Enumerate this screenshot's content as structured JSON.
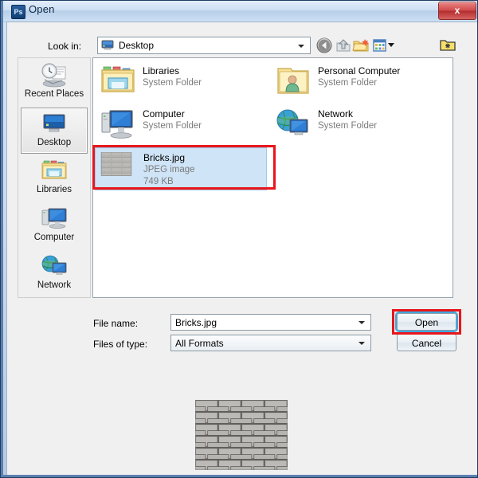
{
  "window": {
    "title": "Open",
    "app_icon": "photoshop-ps-icon",
    "close_label": "x"
  },
  "toolbar": {
    "lookin_label": "Look in:",
    "lookin_value": "Desktop",
    "lookin_icon": "desktop-monitor-icon",
    "buttons": [
      {
        "name": "back-icon",
        "tooltip": "Back"
      },
      {
        "name": "up-folder-icon",
        "tooltip": "Up one level"
      },
      {
        "name": "new-folder-icon",
        "tooltip": "Create new folder"
      },
      {
        "name": "views-icon",
        "tooltip": "Views"
      },
      {
        "name": "special-folder-icon",
        "tooltip": "Special folder"
      }
    ]
  },
  "places": [
    {
      "label": "Recent Places",
      "icon": "recent-places-icon",
      "selected": false
    },
    {
      "label": "Desktop",
      "icon": "desktop-icon",
      "selected": true
    },
    {
      "label": "Libraries",
      "icon": "libraries-folder-icon",
      "selected": false
    },
    {
      "label": "Computer",
      "icon": "computer-icon",
      "selected": false
    },
    {
      "label": "Network",
      "icon": "network-globe-icon",
      "selected": false
    }
  ],
  "files": [
    {
      "name": "Libraries",
      "subtitle": "System Folder",
      "size": "",
      "icon": "libraries-folder-icon",
      "selected": false,
      "annotated": false
    },
    {
      "name": "Computer",
      "subtitle": "System Folder",
      "size": "",
      "icon": "computer-icon",
      "selected": false,
      "annotated": false
    },
    {
      "name": "Bricks.jpg",
      "subtitle": "JPEG image",
      "size": "749 KB",
      "icon": "brick-thumbnail-icon",
      "selected": true,
      "annotated": true
    },
    {
      "name": "Personal Computer",
      "subtitle": "System Folder",
      "size": "",
      "icon": "user-folder-icon",
      "selected": false,
      "annotated": false
    },
    {
      "name": "Network",
      "subtitle": "System Folder",
      "size": "",
      "icon": "network-globe-icon",
      "selected": false,
      "annotated": false
    }
  ],
  "form": {
    "filename_label": "File name:",
    "filename_value": "Bricks.jpg",
    "filetype_label": "Files of type:",
    "filetype_value": "All Formats"
  },
  "actions": {
    "open_label": "Open",
    "cancel_label": "Cancel"
  },
  "preview": {
    "name": "brick-wall-preview"
  },
  "colors": {
    "annotation_red": "#e8161c",
    "selection_blue": "#cfe4f7",
    "focus_glow": "#3ea9e0",
    "titlebar_blue": "#b8cfe9"
  }
}
